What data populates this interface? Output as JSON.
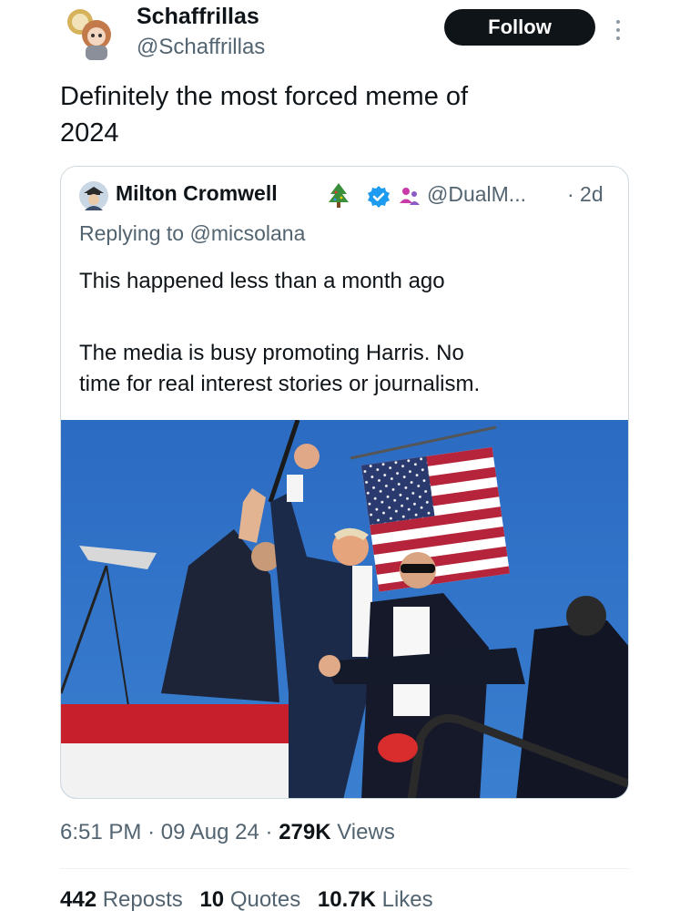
{
  "author": {
    "name": "Schaffrillas",
    "handle": "@Schaffrillas",
    "follow_label": "Follow"
  },
  "tweet": {
    "text_line1": "Definitely the most forced meme of",
    "text_line2": "2024"
  },
  "quoted": {
    "name": "Milton Cromwell",
    "handle": "@DualM...",
    "time": "· 2d",
    "replying_prefix": "Replying to ",
    "replying_handle": "@micsolana",
    "body_line1": "This happened less than a month ago",
    "body_line2": "The media is busy promoting Harris. No",
    "body_line3": "time for real interest stories or journalism.",
    "badge_icons": [
      "tree-icon",
      "verified-badge-icon",
      "group-icon"
    ]
  },
  "meta": {
    "time": "6:51 PM",
    "date": "09 Aug 24",
    "views_count": "279K",
    "views_label": "Views",
    "sep": "·"
  },
  "stats": {
    "reposts_count": "442",
    "reposts_label": "Reposts",
    "quotes_count": "10",
    "quotes_label": "Quotes",
    "likes_count": "10.7K",
    "likes_label": "Likes"
  },
  "colors": {
    "text": "#0f1419",
    "secondary": "#536471",
    "border": "#cfd9de",
    "verified": "#1d9bf0",
    "sky": "#2d6fc4"
  }
}
